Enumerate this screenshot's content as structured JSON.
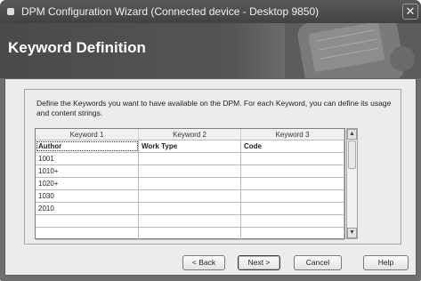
{
  "window": {
    "title": "DPM Configuration Wizard (Connected device - Desktop 9850)",
    "close_glyph": "✕"
  },
  "header": {
    "heading": "Keyword Definition"
  },
  "instructions": "Define the Keywords you want to have available on the DPM. For each Keyword, you can define its usage and content strings.",
  "grid": {
    "column_headers": [
      "Keyword 1",
      "Keyword 2",
      "Keyword 3"
    ],
    "rows": [
      [
        "Author",
        "Work Type",
        "Code"
      ],
      [
        "1001",
        "",
        ""
      ],
      [
        "1010+",
        "",
        ""
      ],
      [
        "1020+",
        "",
        ""
      ],
      [
        "1030",
        "",
        ""
      ],
      [
        "2010",
        "",
        ""
      ],
      [
        "",
        "",
        ""
      ],
      [
        "",
        "",
        ""
      ]
    ]
  },
  "scrollbar": {
    "up_glyph": "▲",
    "down_glyph": "▼"
  },
  "buttons": {
    "back": "< Back",
    "next": "Next >",
    "cancel": "Cancel",
    "help": "Help"
  },
  "icons": {
    "app": "app-icon",
    "close": "close-icon",
    "device": "recorder-device-icon"
  }
}
